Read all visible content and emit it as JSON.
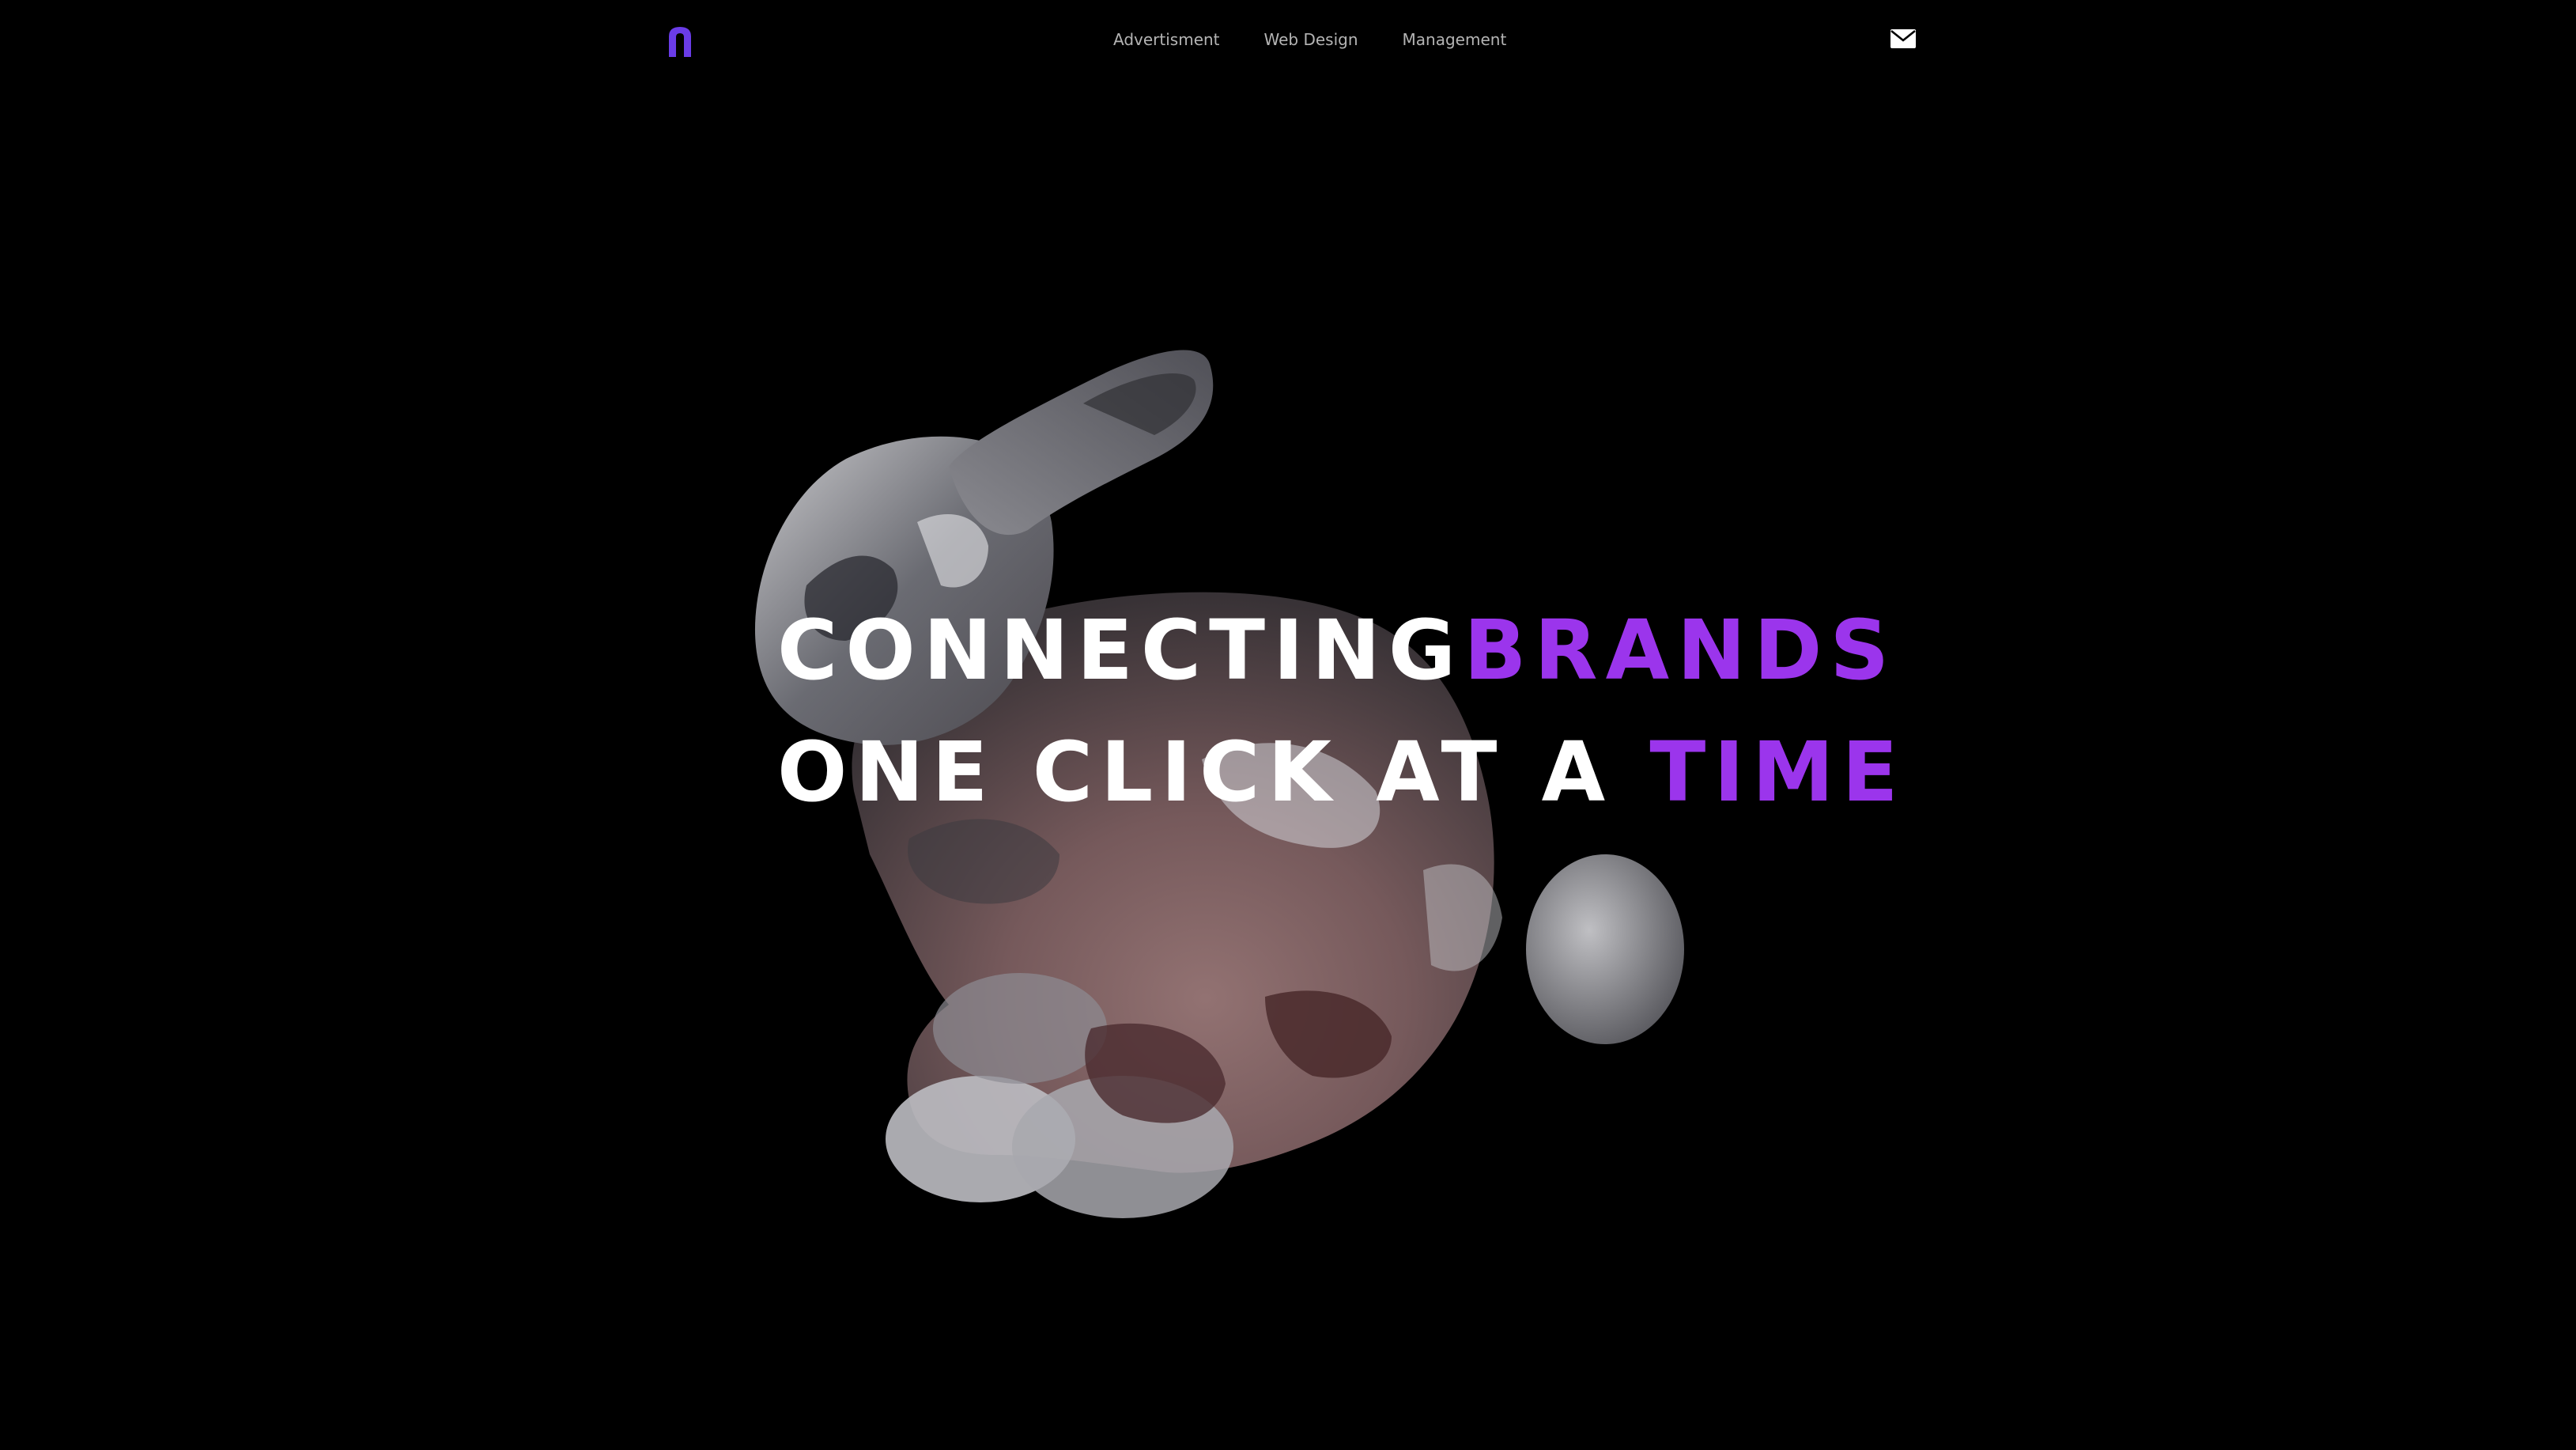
{
  "header": {
    "nav": [
      {
        "label": "Advertisment"
      },
      {
        "label": "Web Design"
      },
      {
        "label": "Management"
      }
    ],
    "logo_icon": "n-logo-icon",
    "mail_icon": "envelope-icon"
  },
  "hero": {
    "line1_white": "CONNECTING",
    "line1_accent": "BRANDS",
    "line2_white": "ONE CLICK AT A ",
    "line2_accent": "TIME",
    "image": "glass-bunny-3d-render"
  },
  "colors": {
    "background": "#000000",
    "accent": "#9b35ec",
    "logo": "#6a3ce8",
    "text": "#ffffff",
    "nav_text": "#b4b4b4"
  }
}
